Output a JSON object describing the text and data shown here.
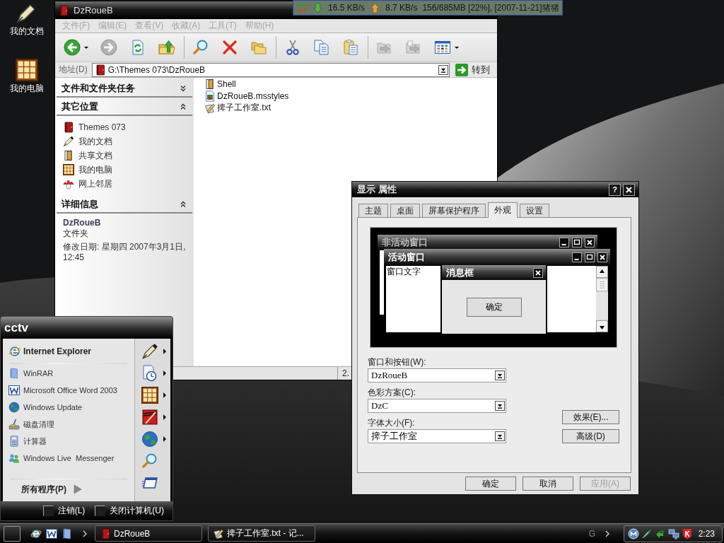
{
  "desktop": {
    "icons": [
      {
        "label": "我的文档",
        "kind": "pen"
      },
      {
        "label": "我的电脑",
        "kind": "grid"
      }
    ]
  },
  "explorer": {
    "title": "DzRoueB",
    "menu": [
      {
        "label": "文件(F)",
        "disabled": true
      },
      {
        "label": "编辑(E)",
        "disabled": true
      },
      {
        "label": "查看(V)",
        "disabled": true
      },
      {
        "label": "收藏(A)",
        "disabled": true
      },
      {
        "label": "工具(T)",
        "disabled": true
      },
      {
        "label": "帮助(H)",
        "disabled": true
      }
    ],
    "toolbar": [
      {
        "buttons": [
          {
            "kind": "back",
            "disabled": false,
            "menu": true
          },
          {
            "kind": "forward",
            "disabled": true,
            "menu": false
          },
          {
            "kind": "refresh",
            "disabled": false,
            "menu": false
          },
          {
            "kind": "up",
            "disabled": false,
            "menu": false
          }
        ]
      },
      {
        "buttons": [
          {
            "kind": "search",
            "disabled": false,
            "menu": false
          },
          {
            "kind": "delete",
            "disabled": false,
            "menu": false
          },
          {
            "kind": "folders",
            "disabled": false,
            "menu": false
          }
        ]
      },
      {
        "buttons": [
          {
            "kind": "cut",
            "disabled": false,
            "menu": false
          },
          {
            "kind": "copy",
            "disabled": false,
            "menu": false
          },
          {
            "kind": "paste",
            "disabled": false,
            "menu": false
          }
        ]
      },
      {
        "buttons": [
          {
            "kind": "move",
            "disabled": true,
            "menu": false
          },
          {
            "kind": "copy_to",
            "disabled": true,
            "menu": false
          },
          {
            "kind": "views",
            "disabled": false,
            "menu": true
          }
        ]
      }
    ],
    "address": {
      "label": "地址(D)",
      "value": "G:\\Themes 073\\DzRoueB",
      "go": "转到"
    },
    "panes": [
      {
        "title": "文件和文件夹任务",
        "expanded": false
      },
      {
        "title": "其它位置",
        "expanded": true,
        "links": [
          {
            "label": "Themes 073",
            "kind": "book"
          },
          {
            "label": "我的文档",
            "kind": "pen"
          },
          {
            "label": "共享文档",
            "kind": "door"
          },
          {
            "label": "我的电脑",
            "kind": "grid"
          },
          {
            "label": "网上邻居",
            "kind": "mushroom"
          }
        ]
      },
      {
        "title": "详细信息",
        "expanded": true,
        "details": {
          "name": "DzRoueB",
          "type": "文件夹",
          "modified": "修改日期: 星期四 2007年3月1日, 12:45"
        }
      }
    ],
    "files": [
      {
        "name": "Shell",
        "kind": "door"
      },
      {
        "name": "DzRoueB.msstyles",
        "kind": "image"
      },
      {
        "name": "捭子工作室.txt",
        "kind": "text"
      }
    ],
    "status_bar": "2."
  },
  "net_monitor": {
    "download": "16.5 KB/s",
    "upload": "8.7 KB/s",
    "info": "156/685MB [22%], [2007-11-21]猪猪"
  },
  "display_properties": {
    "title": "显示 属性",
    "help": "?",
    "tabs": [
      {
        "label": "主题",
        "selected": false
      },
      {
        "label": "桌面",
        "selected": false
      },
      {
        "label": "屏幕保护程序",
        "selected": false
      },
      {
        "label": "外观",
        "selected": true
      },
      {
        "label": "设置",
        "selected": false
      }
    ],
    "preview": {
      "inactive_title": "非活动窗口",
      "active_title": "活动窗口",
      "window_text": "窗口文字",
      "message_title": "消息框",
      "message_button": "确定"
    },
    "fields": [
      {
        "label": "窗口和按钮(W):",
        "value": "DzRoueB"
      },
      {
        "label": "色彩方案(C):",
        "value": "DzC"
      },
      {
        "label": "字体大小(F):",
        "value": "捭子工作室"
      }
    ],
    "side_buttons": [
      "效果(E)...",
      "高级(D)"
    ],
    "buttons": [
      {
        "label": "确定",
        "disabled": false
      },
      {
        "label": "取消",
        "disabled": false
      },
      {
        "label": "应用(A)",
        "disabled": true
      }
    ]
  },
  "start_menu": {
    "user": "cctv",
    "pinned": [
      {
        "label": "Internet Explorer",
        "kind": "ie"
      }
    ],
    "recent": [
      {
        "label": "WinRAR",
        "kind": "archive"
      },
      {
        "label": "Microsoft Office Word 2003",
        "kind": "word"
      },
      {
        "label": "Windows Update",
        "kind": "globe"
      },
      {
        "label": "磁盘清理",
        "kind": "cleanup"
      },
      {
        "label": "计算器",
        "kind": "calculator"
      },
      {
        "label": "Windows Live  Messenger",
        "kind": "messenger"
      }
    ],
    "all_programs": "所有程序(P)",
    "places": [
      {
        "kind": "pen",
        "submenu": true
      },
      {
        "kind": "clock_doc",
        "submenu": true
      },
      {
        "kind": "grid",
        "submenu": true
      },
      {
        "kind": "pen_card",
        "submenu": true
      },
      {
        "kind": "globe",
        "submenu": true
      },
      {
        "kind": "search",
        "submenu": false
      },
      {
        "kind": "run",
        "submenu": false
      }
    ],
    "footer": [
      {
        "label": "注销(L)"
      },
      {
        "label": "关闭计算机(U)"
      }
    ]
  },
  "taskbar": {
    "quick_launch": [
      {
        "kind": "ie"
      },
      {
        "kind": "word"
      },
      {
        "kind": "archive"
      }
    ],
    "tasks": [
      {
        "label": "DzRoueB",
        "kind": "book",
        "selected": false
      },
      {
        "label": "捭子工作室.txt - 记...",
        "kind": "text",
        "selected": false
      }
    ],
    "language": "G",
    "tray": [
      {
        "kind": "m_circle"
      },
      {
        "kind": "feather"
      },
      {
        "kind": "arrows"
      },
      {
        "kind": "monitors"
      },
      {
        "kind": "k_shield"
      }
    ],
    "clock": "2:23"
  }
}
